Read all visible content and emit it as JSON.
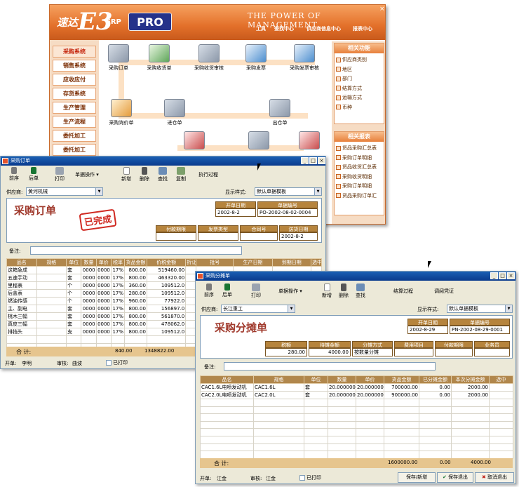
{
  "erp": {
    "brand_prefix": "速达",
    "brand_mark": "E3",
    "brand_suffix": "ERP",
    "edition": "PRO",
    "slogan": "THE POWER OF MANAGEMENT",
    "close": "×",
    "top_menu": [
      "工具",
      "查找中心",
      "供应商信息中心",
      "报表中心"
    ],
    "left_nav": [
      "采购系统",
      "销售系统",
      "应收应付",
      "存货系统",
      "生产管理",
      "生产流程",
      "委托加工",
      "委托加工"
    ],
    "flow_nodes": {
      "n1": "采购订单",
      "n2": "采购收货单",
      "n3": "采购收货审核",
      "n4": "采购发票",
      "n5": "采购发票审核",
      "n6": "采购询价单",
      "n7": "进仓单",
      "n8": "出仓单"
    },
    "related_functions": {
      "title": "相关功能",
      "items": [
        "供应商类别",
        "地区",
        "部门",
        "结算方式",
        "运输方式",
        "币种"
      ]
    },
    "related_reports": {
      "title": "相关报表",
      "items": [
        "货品采购汇总表",
        "采购订单明细",
        "货品收货汇总表",
        "采购收货明细",
        "采购订单明细",
        "货品采购订单汇"
      ]
    }
  },
  "po": {
    "title": "采购订单",
    "toolbar": [
      "前序",
      "后单",
      "打印",
      "单据操作",
      "新增",
      "删除",
      "查找",
      "复制",
      "执行过程"
    ],
    "supplier_label": "供应商:",
    "supplier_value": "黄河机械",
    "display_label": "显示样式:",
    "display_value": "默认单据模板",
    "doc_title": "采购订单",
    "stamp": "已完成",
    "open_date_label": "开单日期",
    "open_date": "2002-8-2",
    "doc_no_label": "单据编号",
    "doc_no": "PO-2002-08-02-0004",
    "pay_label": "付款期限",
    "invoice_label": "发票类型",
    "contract_label": "合同号",
    "delivery_label": "送货日期",
    "delivery_date": "2002-8-2",
    "remark_label": "备注:",
    "columns": [
      "品名",
      "规格",
      "单位",
      "数量",
      "单价",
      "税率",
      "货品金额",
      "价税金额",
      "折让",
      "批号",
      "生产日期",
      "到期日期",
      "选中"
    ],
    "rows": [
      [
        "这箱急成",
        "",
        "套",
        "0000",
        "0000",
        "17%",
        "800.00",
        "519460.00"
      ],
      [
        "五速手动",
        "",
        "套",
        "0000",
        "0000",
        "17%",
        "800.00",
        "463320.00"
      ],
      [
        "里程表",
        "",
        "个",
        "0000",
        "0000",
        "17%",
        "360.00",
        "109512.0"
      ],
      [
        "后盖表",
        "",
        "个",
        "0000",
        "0000",
        "17%",
        "280.00",
        "109512.0"
      ],
      [
        "燃油传感",
        "",
        "个",
        "0000",
        "0000",
        "17%",
        "960.00",
        "77922.0"
      ],
      [
        "主、副电",
        "",
        "套",
        "0000",
        "0000",
        "17%",
        "800.00",
        "156897.0"
      ],
      [
        "桃木三幅",
        "",
        "套",
        "0000",
        "0000",
        "17%",
        "800.00",
        "561870.0"
      ],
      [
        "真皮三幅",
        "",
        "套",
        "0000",
        "0000",
        "17%",
        "800.00",
        "478062.0"
      ],
      [
        "排挡头",
        "",
        "支",
        "0000",
        "0000",
        "17%",
        "800.00",
        "109512.0"
      ]
    ],
    "sum_label": "合  计:",
    "sum_goods": "840.00",
    "sum_tax": "1348822.00",
    "maker_label": "开单:",
    "maker": "李明",
    "auditor_label": "审核:",
    "auditor": "曲波",
    "printed_label": "已打印"
  },
  "alloc": {
    "title": "采购分摊单",
    "toolbar": [
      "前序",
      "后单",
      "打印",
      "单据操作",
      "新增",
      "删除",
      "查找",
      "结算过程",
      "调阅凭证"
    ],
    "supplier_label": "供应商:",
    "supplier_value": "长江重工",
    "display_label": "显示样式:",
    "display_value": "默认单据模板",
    "doc_title": "采购分摊单",
    "open_date_label": "开单日期",
    "open_date": "2002-8-29",
    "doc_no_label": "单据编号",
    "doc_no": "PN-2002-08-29-0001",
    "fee_label": "税额",
    "fee": "280.00",
    "amount_label": "待摊金额",
    "amount": "4000.00",
    "method_label": "分摊方式",
    "method": "按数量分摊",
    "project_label": "费用项目",
    "pay_label": "付款期限",
    "clerk_label": "业务员",
    "remark_label": "备注:",
    "columns": [
      "品名",
      "规格",
      "单位",
      "数量",
      "单价",
      "货品金额",
      "已分摊金额",
      "本次分摊金额",
      "选中"
    ],
    "rows": [
      [
        "CAC1.6L电喷发动机",
        "CAC1.6L",
        "套",
        "20.000000",
        "20.000000",
        "700000.00",
        "0.00",
        "2000.00"
      ],
      [
        "CAC2.0L电喷发动机",
        "CAC2.0L",
        "套",
        "20.000000",
        "20.000000",
        "900000.00",
        "0.00",
        "2000.00"
      ]
    ],
    "sum_label": "合  计:",
    "sum_goods": "1600000.00",
    "sum_done": "0.00",
    "sum_now": "4000.00",
    "maker_label": "开单:",
    "maker": "江金",
    "auditor_label": "审核:",
    "auditor": "江金",
    "printed_label": "已打印",
    "btn_save_new": "保存/新增",
    "btn_save_exit": "保存退出",
    "btn_cancel_exit": "取消退出"
  }
}
